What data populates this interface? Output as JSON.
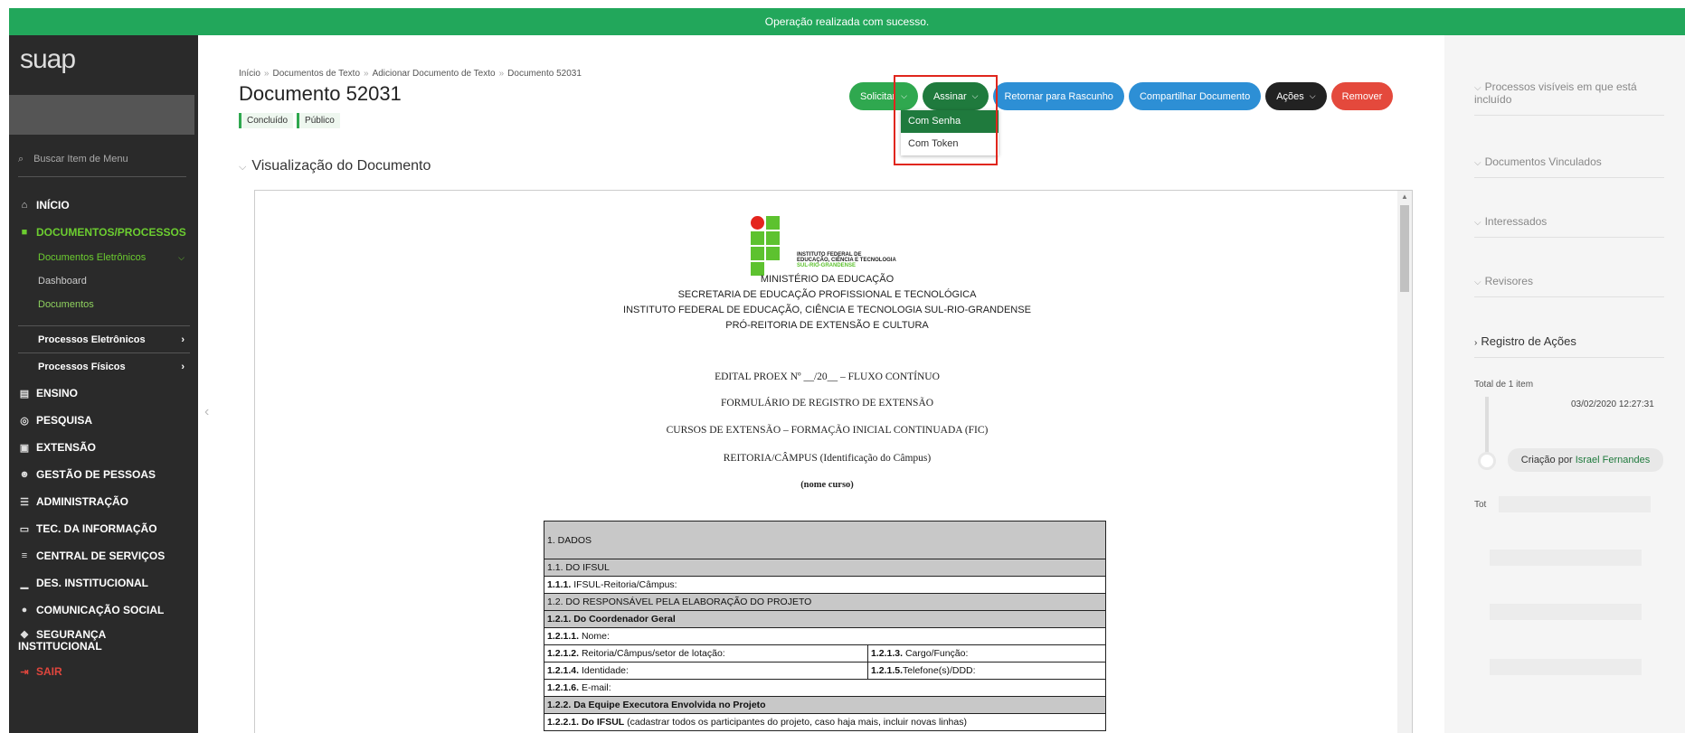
{
  "notification": "Operação realizada com sucesso.",
  "sidebar": {
    "logo": "suap",
    "search_placeholder": "Buscar Item de Menu",
    "items": {
      "inicio": "INÍCIO",
      "documentos": "DOCUMENTOS/PROCESSOS",
      "docs_eletronicos": "Documentos Eletrônicos",
      "dashboard": "Dashboard",
      "documentos_sub": "Documentos",
      "processos_eletronicos": "Processos Eletrônicos",
      "processos_fisicos": "Processos Físicos",
      "ensino": "ENSINO",
      "pesquisa": "PESQUISA",
      "extensao": "EXTENSÃO",
      "gestao_pessoas": "GESTÃO DE PESSOAS",
      "administracao": "ADMINISTRAÇÃO",
      "tec_informacao": "TEC. DA INFORMAÇÃO",
      "central_servicos": "CENTRAL DE SERVIÇOS",
      "des_institucional": "DES. INSTITUCIONAL",
      "comunicacao_social": "COMUNICAÇÃO SOCIAL",
      "seguranca_1": "SEGURANÇA",
      "seguranca_2": "INSTITUCIONAL",
      "sair": "SAIR"
    }
  },
  "breadcrumb": [
    "Início",
    "Documentos de Texto",
    "Adicionar Documento de Texto",
    "Documento 52031"
  ],
  "page_title": "Documento 52031",
  "badges": [
    "Concluído",
    "Público"
  ],
  "toolbar": {
    "solicitar": "Solicitar",
    "assinar": "Assinar",
    "retornar": "Retornar para Rascunho",
    "compartilhar": "Compartilhar Documento",
    "acoes": "Ações",
    "remover": "Remover"
  },
  "assinar_menu": [
    "Com Senha",
    "Com Token"
  ],
  "section_title": "Visualização do Documento",
  "document": {
    "logo_text_1": "INSTITUTO FEDERAL DE",
    "logo_text_2": "EDUCAÇÃO, CIÊNCIA E TECNOLOGIA",
    "logo_text_3": "SUL-RIO-GRANDENSE",
    "header_lines": [
      "MINISTÉRIO DA EDUCAÇÃO",
      "SECRETARIA DE EDUCAÇÃO PROFISSIONAL E TECNOLÓGICA",
      "INSTITUTO FEDERAL DE EDUCAÇÃO, CIÊNCIA E TECNOLOGIA SUL-RIO-GRANDENSE",
      "PRÓ-REITORIA DE EXTENSÃO E CULTURA"
    ],
    "edital": "EDITAL PROEX Nº __/20__ – FLUXO CONTÍNUO",
    "formulario": "FORMULÁRIO DE REGISTRO DE EXTENSÃO",
    "cursos": "CURSOS DE EXTENSÃO – FORMAÇÃO INICIAL CONTINUADA (FIC)",
    "reitoria": "REITORIA/CÂMPUS (Identificação do Câmpus)",
    "nome_curso": "(nome curso)",
    "table": {
      "dados": "1. DADOS",
      "r11": "1.1. DO IFSUL",
      "r111_b": "1.1.1.",
      "r111_t": "IFSUL-Reitoria/Câmpus:",
      "r12": "1.2. DO RESPONSÁVEL PELA ELABORAÇÃO DO PROJETO",
      "r121": "1.2.1. Do Coordenador Geral",
      "r1211_b": "1.2.1.1.",
      "r1211_t": "Nome:",
      "r1212_b": "1.2.1.2.",
      "r1212_t": "Reitoria/Câmpus/setor de lotação:",
      "r1213_b": "1.2.1.3.",
      "r1213_t": "Cargo/Função:",
      "r1214_b": "1.2.1.4.",
      "r1214_t": "Identidade:",
      "r1215_b": "1.2.1.5.",
      "r1215_t": "Telefone(s)/DDD:",
      "r1216_b": "1.2.1.6.",
      "r1216_t": "E-mail:",
      "r122": "1.2.2. Da Equipe Executora Envolvida no Projeto",
      "r1221_b": "1.2.2.1. Do IFSUL",
      "r1221_t": "(cadastrar todos os participantes do projeto, caso haja mais, incluir novas linhas)"
    }
  },
  "right_panel": {
    "processos": "Processos visíveis em que está incluído",
    "vinculados": "Documentos Vinculados",
    "interessados": "Interessados",
    "revisores": "Revisores",
    "registro": "Registro de Ações",
    "total": "Total de 1 item",
    "date": "03/02/2020 12:27:31",
    "criacao": "Criação por",
    "autor": "Israel Fernandes",
    "tot": "Tot"
  },
  "colors": {
    "success": "#22a75b",
    "sidebar": "#2a2a2a",
    "active_green": "#6ccd30",
    "blue": "#2d8fd5",
    "red": "#e4493c"
  }
}
